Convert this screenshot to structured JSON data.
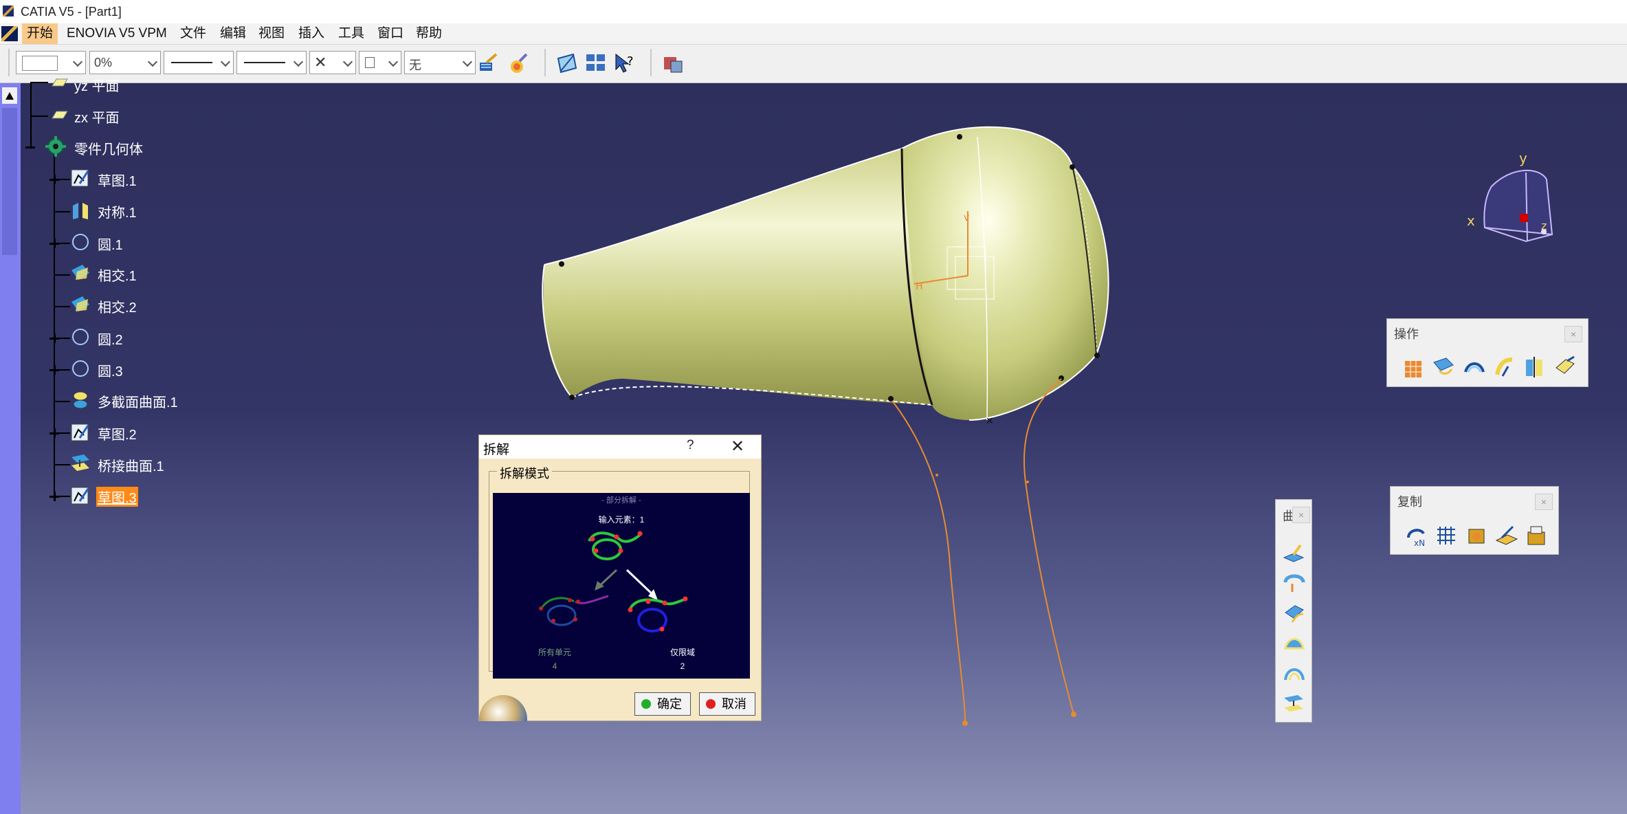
{
  "window": {
    "title": "CATIA V5 - [Part1]"
  },
  "menu": {
    "items": [
      "开始",
      "ENOVIA V5 VPM",
      "文件",
      "编辑",
      "视图",
      "插入",
      "工具",
      "窗口",
      "帮助"
    ]
  },
  "toolbar": {
    "combo1_value": "",
    "combo2_value": "0%",
    "combo3_value": "",
    "combo4_value": "",
    "combo5_value": "",
    "combo6_value": "",
    "layer_value": "无",
    "icons": [
      "painter-icon",
      "paint-bucket-icon",
      "fly-mode-icon",
      "compass-grid-icon",
      "whats-this-icon",
      "catalog-icon"
    ]
  },
  "tree": {
    "items": [
      {
        "label": "yz 平面",
        "icon": "plane-icon"
      },
      {
        "label": "zx 平面",
        "icon": "plane-icon"
      },
      {
        "label": "零件几何体",
        "icon": "body-gear-icon"
      },
      {
        "label": "草图.1",
        "icon": "sketch-icon"
      },
      {
        "label": "对称.1",
        "icon": "symmetry-icon"
      },
      {
        "label": "圆.1",
        "icon": "circle-icon"
      },
      {
        "label": "相交.1",
        "icon": "intersection-icon"
      },
      {
        "label": "相交.2",
        "icon": "intersection-icon"
      },
      {
        "label": "圆.2",
        "icon": "circle-icon"
      },
      {
        "label": "圆.3",
        "icon": "circle-icon"
      },
      {
        "label": "多截面曲面.1",
        "icon": "multisection-surface-icon"
      },
      {
        "label": "草图.2",
        "icon": "sketch-icon"
      },
      {
        "label": "桥接曲面.1",
        "icon": "blend-surface-icon"
      },
      {
        "label": "草图.3",
        "icon": "sketch-icon"
      }
    ]
  },
  "compass": {
    "x_label": "x",
    "y_label": "y",
    "z_label": "z"
  },
  "dialog": {
    "title": "拆解",
    "help": "?",
    "close": "✕",
    "group_label": "拆解模式",
    "preview": {
      "top_caption": "- 部分拆解 -",
      "input_caption": "输入元素：1",
      "left_caption": "所有单元",
      "left_count": "4",
      "right_caption": "仅限域",
      "right_count": "2"
    },
    "ok_label": "确定",
    "cancel_label": "取消"
  },
  "toolbars": {
    "operations": {
      "title": "操作",
      "close": "×",
      "icons": [
        "join-icon",
        "healing-icon",
        "untrim-icon",
        "split-icon",
        "trim-icon",
        "extract-icon"
      ]
    },
    "replication": {
      "title": "复制",
      "close": "×",
      "icons": [
        "rotate-repeat-icon",
        "pattern-icon",
        "power-copy-icon",
        "user-feature-icon",
        "catalog-save-icon"
      ]
    },
    "vertical": {
      "title": "曲",
      "close": "×",
      "icons": [
        "extrude-surface-icon",
        "revolve-surface-icon",
        "sweep-icon",
        "fill-icon",
        "multisection-icon",
        "blend-icon"
      ]
    }
  }
}
